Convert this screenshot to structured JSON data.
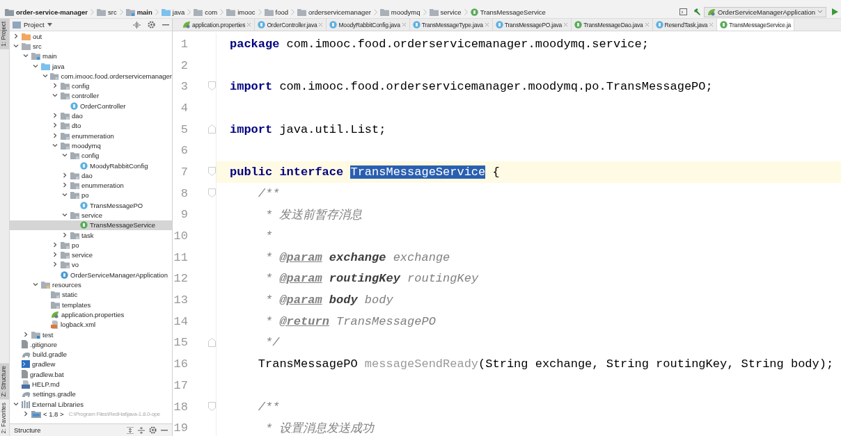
{
  "breadcrumb": [
    {
      "label": "order-service-manager",
      "kind": "module"
    },
    {
      "label": "src",
      "kind": "folder"
    },
    {
      "label": "main",
      "kind": "source"
    },
    {
      "label": "java",
      "kind": "source-root"
    },
    {
      "label": "com",
      "kind": "folder"
    },
    {
      "label": "imooc",
      "kind": "folder"
    },
    {
      "label": "food",
      "kind": "folder"
    },
    {
      "label": "orderservicemanager",
      "kind": "folder"
    },
    {
      "label": "moodymq",
      "kind": "folder"
    },
    {
      "label": "service",
      "kind": "folder"
    },
    {
      "label": "TransMessageService",
      "kind": "interface"
    }
  ],
  "run_config": {
    "label": "OrderServiceManagerApplication"
  },
  "side_tabs_top": [
    {
      "label": "1: Project",
      "selected": true
    }
  ],
  "side_tabs_bottom": [
    {
      "label": "Z: Structure",
      "selected": true
    },
    {
      "label": "2: Favorites",
      "selected": false
    }
  ],
  "project_panel": {
    "title": "Project",
    "tree": [
      {
        "label": "out",
        "kind": "excluded",
        "expanded": false,
        "selected": false
      },
      {
        "label": "src",
        "kind": "folder",
        "expanded": true,
        "selected": false,
        "children": [
          {
            "label": "main",
            "kind": "source",
            "expanded": true,
            "selected": false,
            "children": [
              {
                "label": "java",
                "kind": "source-root",
                "expanded": true,
                "selected": false,
                "children": [
                  {
                    "label": "com.imooc.food.orderservicemanager",
                    "kind": "package",
                    "expanded": true,
                    "selected": false,
                    "children": [
                      {
                        "label": "config",
                        "kind": "package",
                        "expanded": false,
                        "selected": false
                      },
                      {
                        "label": "controller",
                        "kind": "package",
                        "expanded": true,
                        "selected": false,
                        "children": [
                          {
                            "label": "OrderController",
                            "kind": "class",
                            "selected": false
                          }
                        ]
                      },
                      {
                        "label": "dao",
                        "kind": "package",
                        "expanded": false,
                        "selected": false
                      },
                      {
                        "label": "dto",
                        "kind": "package",
                        "expanded": false,
                        "selected": false
                      },
                      {
                        "label": "enummeration",
                        "kind": "package",
                        "expanded": false,
                        "selected": false
                      },
                      {
                        "label": "moodymq",
                        "kind": "package",
                        "expanded": true,
                        "selected": false,
                        "children": [
                          {
                            "label": "config",
                            "kind": "package",
                            "expanded": true,
                            "selected": false,
                            "children": [
                              {
                                "label": "MoodyRabbitConfig",
                                "kind": "class",
                                "selected": false
                              }
                            ]
                          },
                          {
                            "label": "dao",
                            "kind": "package",
                            "expanded": false,
                            "selected": false
                          },
                          {
                            "label": "enummeration",
                            "kind": "package",
                            "expanded": false,
                            "selected": false
                          },
                          {
                            "label": "po",
                            "kind": "package",
                            "expanded": true,
                            "selected": false,
                            "children": [
                              {
                                "label": "TransMessagePO",
                                "kind": "class",
                                "selected": false
                              }
                            ]
                          },
                          {
                            "label": "service",
                            "kind": "package",
                            "expanded": true,
                            "selected": false,
                            "children": [
                              {
                                "label": "TransMessageService",
                                "kind": "interface",
                                "selected": true
                              }
                            ]
                          },
                          {
                            "label": "task",
                            "kind": "package",
                            "expanded": false,
                            "selected": false
                          }
                        ]
                      },
                      {
                        "label": "po",
                        "kind": "package",
                        "expanded": false,
                        "selected": false
                      },
                      {
                        "label": "service",
                        "kind": "package",
                        "expanded": false,
                        "selected": false
                      },
                      {
                        "label": "vo",
                        "kind": "package",
                        "expanded": false,
                        "selected": false
                      },
                      {
                        "label": "OrderServiceManagerApplication",
                        "kind": "app",
                        "selected": false
                      }
                    ]
                  }
                ]
              },
              {
                "label": "resources",
                "kind": "resources",
                "expanded": true,
                "selected": false,
                "children": [
                  {
                    "label": "static",
                    "kind": "package",
                    "selected": false
                  },
                  {
                    "label": "templates",
                    "kind": "package",
                    "selected": false
                  },
                  {
                    "label": "application.properties",
                    "kind": "properties",
                    "selected": false
                  },
                  {
                    "label": "logback.xml",
                    "kind": "xml",
                    "selected": false
                  }
                ]
              }
            ]
          },
          {
            "label": "test",
            "kind": "test",
            "expanded": false,
            "selected": false
          }
        ]
      },
      {
        "label": ".gitignore",
        "kind": "file",
        "selected": false
      },
      {
        "label": "build.gradle",
        "kind": "gradle",
        "selected": false
      },
      {
        "label": "gradlew",
        "kind": "shell",
        "selected": false
      },
      {
        "label": "gradlew.bat",
        "kind": "file",
        "selected": false
      },
      {
        "label": "HELP.md",
        "kind": "markdown",
        "selected": false
      },
      {
        "label": "settings.gradle",
        "kind": "gradle",
        "selected": false
      },
      {
        "label": "External Libraries",
        "kind": "libraries",
        "expanded": true,
        "selected": false,
        "children": [
          {
            "label": "< 1.8 >",
            "kind": "jdk",
            "expanded": false,
            "selected": false,
            "detail": "C:\\Program Files\\RedHat\\java-1.8.0-ope"
          }
        ]
      }
    ]
  },
  "structure_panel": {
    "title": "Structure"
  },
  "editor_tabs": [
    {
      "label": "application.properties",
      "kind": "properties",
      "selected": false
    },
    {
      "label": "OrderController.java",
      "kind": "class",
      "selected": false
    },
    {
      "label": "MoodyRabbitConfig.java",
      "kind": "class",
      "selected": false
    },
    {
      "label": "TransMessageType.java",
      "kind": "class",
      "selected": false
    },
    {
      "label": "TransMessagePO.java",
      "kind": "class",
      "selected": false
    },
    {
      "label": "TransMessageDao.java",
      "kind": "interface",
      "selected": false
    },
    {
      "label": "ResendTask.java",
      "kind": "class",
      "selected": false
    },
    {
      "label": "TransMessageService.ja",
      "kind": "interface",
      "selected": true
    }
  ],
  "editor": {
    "lines": [
      {
        "number": "1",
        "current": false,
        "tokens": [
          {
            "kind": "keyword",
            "text": "package"
          },
          {
            "kind": "plain",
            "text": " com.imooc.food.orderservicemanager.moodymq.service;"
          }
        ]
      },
      {
        "number": "2",
        "current": false
      },
      {
        "number": "3",
        "current": false,
        "fold_start": true,
        "tokens": [
          {
            "kind": "keyword",
            "text": "import"
          },
          {
            "kind": "plain",
            "text": " com.imooc.food.orderservicemanager.moodymq.po.TransMessagePO;"
          }
        ]
      },
      {
        "number": "4",
        "current": false
      },
      {
        "number": "5",
        "current": false,
        "fold_end": true,
        "tokens": [
          {
            "kind": "keyword",
            "text": "import"
          },
          {
            "kind": "plain",
            "text": " java.util.List;"
          }
        ]
      },
      {
        "number": "6",
        "current": false
      },
      {
        "number": "7",
        "current": true,
        "fold_start": true,
        "tokens": [
          {
            "kind": "keyword",
            "text": "public interface "
          },
          {
            "kind": "selected",
            "text": "TransMessageService"
          },
          {
            "kind": "plain",
            "text": " {"
          }
        ]
      },
      {
        "number": "8",
        "current": false,
        "fold_start": true,
        "tokens": [
          {
            "kind": "comment",
            "text": "    /**"
          }
        ]
      },
      {
        "number": "9",
        "current": false,
        "tokens": [
          {
            "kind": "comment",
            "text": "     * 发送前暂存消息"
          }
        ]
      },
      {
        "number": "10",
        "current": false,
        "tokens": [
          {
            "kind": "comment",
            "text": "     *"
          }
        ]
      },
      {
        "number": "11",
        "current": false,
        "tokens": [
          {
            "kind": "comment",
            "text": "     * "
          },
          {
            "kind": "tag",
            "text": "@param"
          },
          {
            "kind": "param",
            "text": " exchange"
          },
          {
            "kind": "comment",
            "text": " exchange"
          }
        ]
      },
      {
        "number": "12",
        "current": false,
        "tokens": [
          {
            "kind": "comment",
            "text": "     * "
          },
          {
            "kind": "tag",
            "text": "@param"
          },
          {
            "kind": "param",
            "text": " routingKey"
          },
          {
            "kind": "comment",
            "text": " routingKey"
          }
        ]
      },
      {
        "number": "13",
        "current": false,
        "tokens": [
          {
            "kind": "comment",
            "text": "     * "
          },
          {
            "kind": "tag",
            "text": "@param"
          },
          {
            "kind": "param",
            "text": " body"
          },
          {
            "kind": "comment",
            "text": " body"
          }
        ]
      },
      {
        "number": "14",
        "current": false,
        "tokens": [
          {
            "kind": "comment",
            "text": "     * "
          },
          {
            "kind": "tag",
            "text": "@return"
          },
          {
            "kind": "comment",
            "text": " TransMessagePO"
          }
        ]
      },
      {
        "number": "15",
        "current": false,
        "fold_end": true,
        "tokens": [
          {
            "kind": "comment",
            "text": "     */"
          }
        ]
      },
      {
        "number": "16",
        "current": false,
        "tokens": [
          {
            "kind": "plain",
            "text": "    TransMessagePO "
          },
          {
            "kind": "unused",
            "text": "messageSendReady"
          },
          {
            "kind": "plain",
            "text": "(String exchange, String routingKey, String body);"
          }
        ]
      },
      {
        "number": "17",
        "current": false
      },
      {
        "number": "18",
        "current": false,
        "fold_start": true,
        "tokens": [
          {
            "kind": "comment",
            "text": "    /**"
          }
        ]
      },
      {
        "number": "19",
        "current": false,
        "tokens": [
          {
            "kind": "comment",
            "text": "     * 设置消息发送成功"
          }
        ]
      }
    ]
  }
}
